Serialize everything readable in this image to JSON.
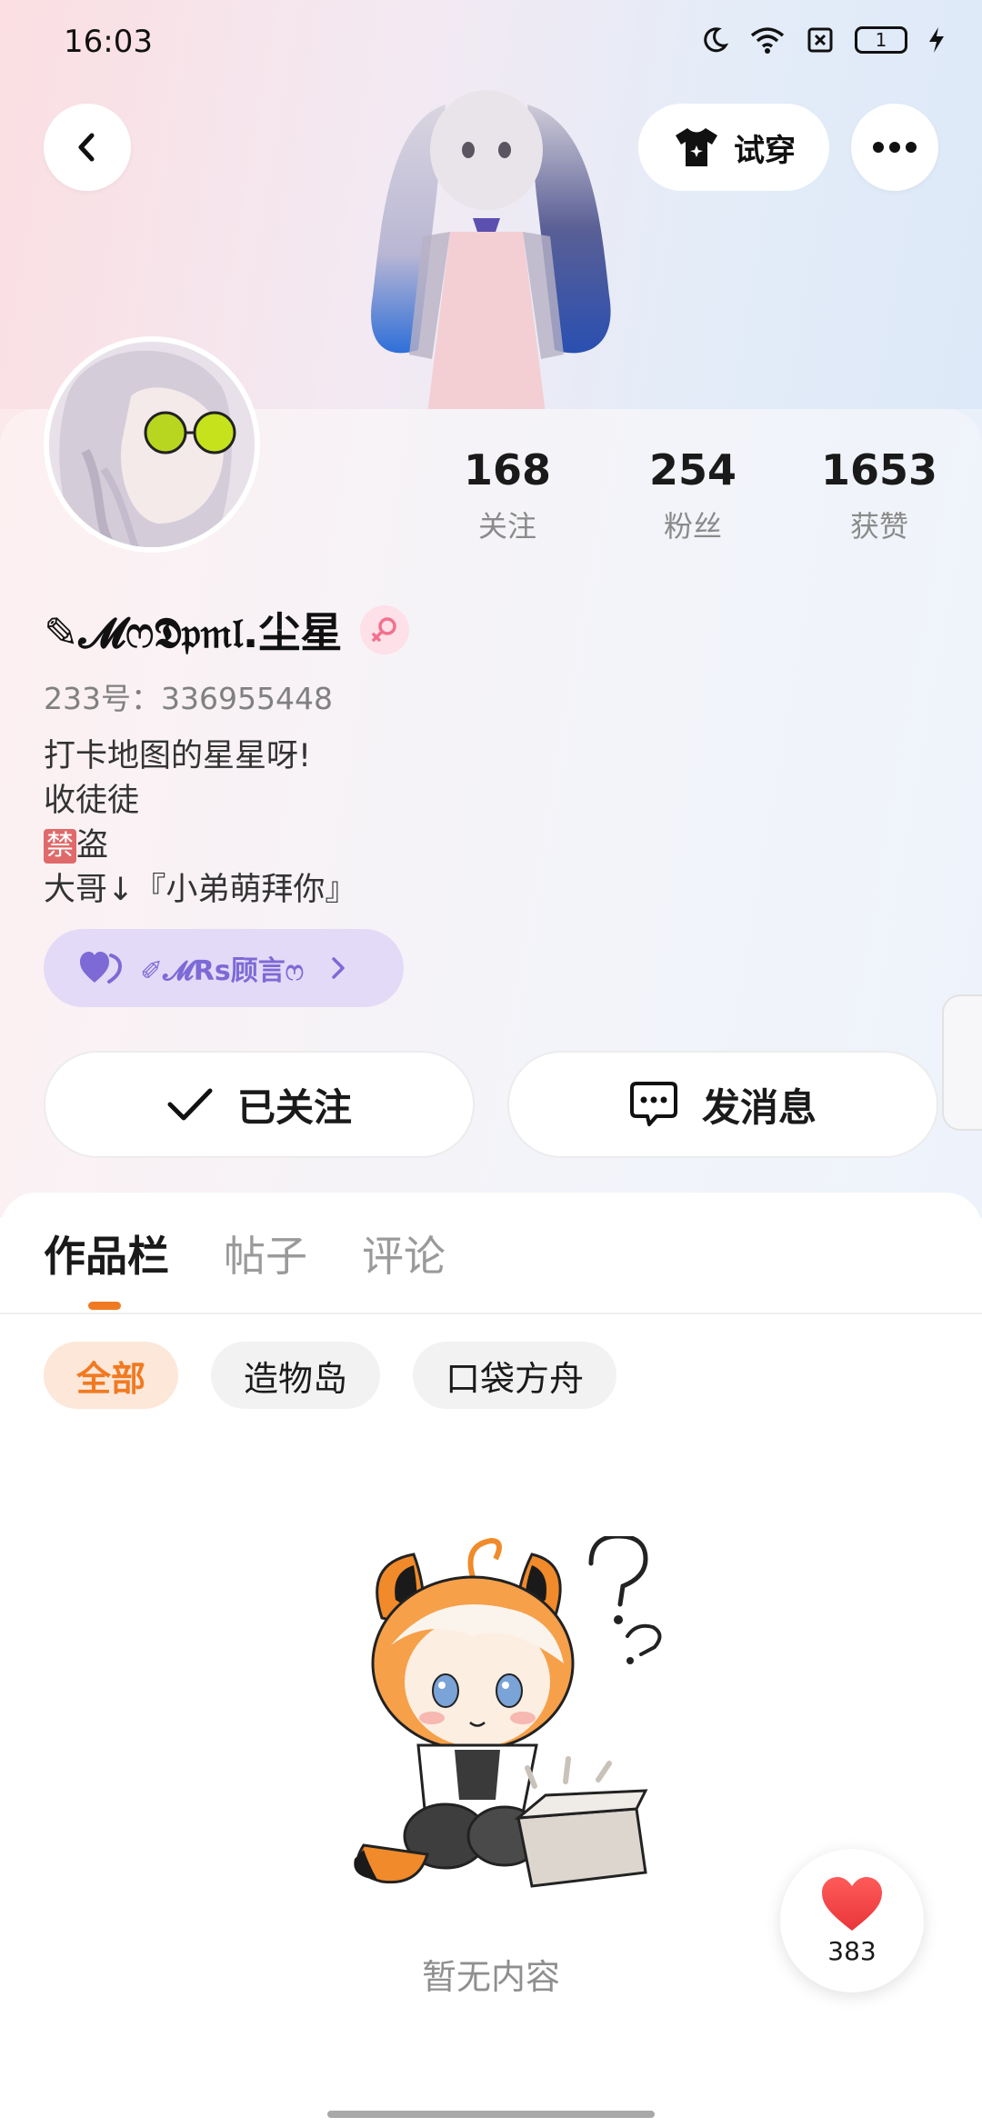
{
  "status_bar": {
    "time": "16:03",
    "battery_level": "1",
    "icons": [
      "moon-icon",
      "wifi-icon",
      "sim-blocked-icon",
      "battery-icon",
      "charging-icon"
    ]
  },
  "header": {
    "tryon_label": "试穿",
    "icons": [
      "back-icon",
      "tshirt-icon",
      "more-icon"
    ]
  },
  "profile": {
    "nickname": "✎𝓜ෆ𝕯𝔭𝔪𝔩.尘星",
    "uid": "233号：336955448",
    "bio": [
      "打卡地图的星星呀!",
      "收徒徒",
      "盗",
      "大哥↓『小弟萌拜你』"
    ],
    "bio_forbidden_tag": "禁",
    "relation": {
      "name": "✐𝓜Rs顾言ෆ",
      "icon": "double-heart-icon"
    },
    "stats": [
      {
        "value": "168",
        "label": "关注"
      },
      {
        "value": "254",
        "label": "粉丝"
      },
      {
        "value": "1653",
        "label": "获赞"
      }
    ]
  },
  "actions": {
    "following_label": "已关注",
    "message_label": "发消息"
  },
  "tabs": [
    {
      "label": "作品栏",
      "active": true
    },
    {
      "label": "帖子",
      "active": false
    },
    {
      "label": "评论",
      "active": false
    }
  ],
  "filters": [
    {
      "label": "全部",
      "active": true
    },
    {
      "label": "造物岛",
      "active": false
    },
    {
      "label": "口袋方舟",
      "active": false
    }
  ],
  "empty_state": {
    "text": "暂无内容"
  },
  "like_button": {
    "count": "383"
  },
  "colors": {
    "accent": "#f07a22",
    "relation_chip_bg": "#e3daf7",
    "relation_chip_text": "#7d6ad6",
    "heart": "#f04545"
  }
}
